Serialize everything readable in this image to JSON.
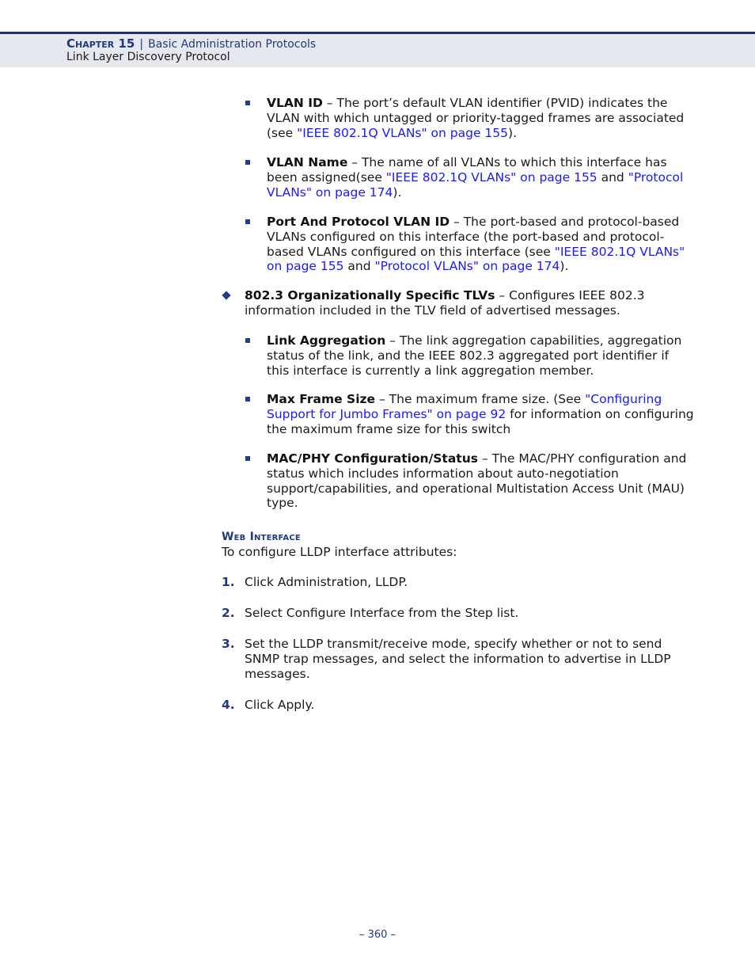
{
  "header": {
    "chapter_label": "Chapter 15",
    "separator": "|",
    "chapter_title": "Basic Administration Protocols",
    "section_title": "Link Layer Discovery Protocol"
  },
  "vlan_items": [
    {
      "term": "VLAN ID",
      "pre": " – The port’s default VLAN identifier (PVID) indicates the VLAN with which untagged or priority-tagged frames are associated (see ",
      "link1": "\"IEEE 802.1Q VLANs\" on page 155",
      "post": ")."
    },
    {
      "term": "VLAN Name",
      "pre": " – The name of all VLANs to which this interface has been assigned(see ",
      "link1": "\"IEEE 802.1Q VLANs\" on page 155",
      "mid": " and ",
      "link2": "\"Protocol VLANs\" on page 174",
      "post": ")."
    },
    {
      "term": "Port And Protocol VLAN ID",
      "pre": " – The port-based and protocol-based VLANs configured on this interface (the port-based and protocol-based VLANs configured on this interface (see ",
      "link1": "\"IEEE 802.1Q VLANs\" on page 155",
      "mid": " and ",
      "link2": "\"Protocol VLANs\" on page 174",
      "post": ")."
    }
  ],
  "tlv_8023": {
    "term": "802.3 Organizationally Specific TLVs",
    "text": " – Configures IEEE 802.3 information included in the TLV field of advertised messages."
  },
  "tlv_items": [
    {
      "term": "Link Aggregation",
      "text": " – The link aggregation capabilities, aggregation status of the link, and the IEEE 802.3 aggregated port identifier if this interface is currently a link aggregation member."
    },
    {
      "term": "Max Frame Size",
      "pre": " – The maximum frame size. (See ",
      "link1": "\"Configuring Support for Jumbo Frames\" on page 92",
      "post": " for information on configuring the maximum frame size for this switch"
    },
    {
      "term": "MAC/PHY Configuration/Status",
      "text": " – The MAC/PHY configuration and status which includes information about auto-negotiation support/capabilities, and operational Multistation Access Unit (MAU) type."
    }
  ],
  "web_interface": {
    "heading": "Web Interface",
    "intro": "To configure LLDP interface attributes:",
    "steps": [
      {
        "num": "1.",
        "text": "Click Administration, LLDP."
      },
      {
        "num": "2.",
        "text": "Select Configure Interface from the Step list."
      },
      {
        "num": "3.",
        "text": "Set the LLDP transmit/receive mode, specify whether or not to send SNMP trap messages, and select the information to advertise in LLDP messages."
      },
      {
        "num": "4.",
        "text": "Click Apply."
      }
    ]
  },
  "footer": {
    "page_number": "–  360  –"
  }
}
